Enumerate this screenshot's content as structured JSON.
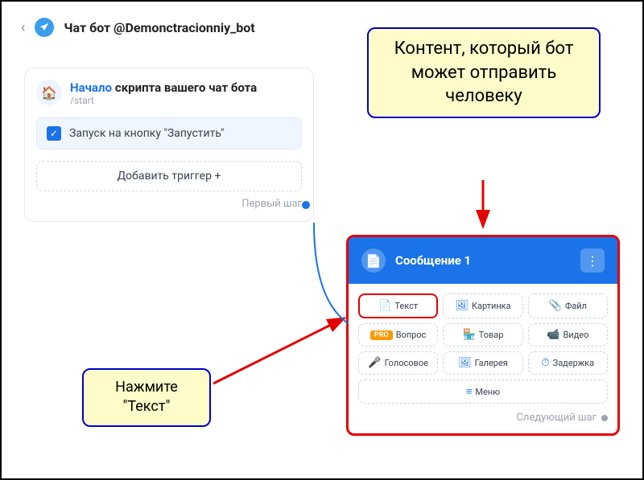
{
  "header": {
    "title": "Чат бот @Demonctracionniy_bot"
  },
  "start_card": {
    "title": "Начало",
    "subtitle_suffix": "скрипта вашего чат бота",
    "command": "/start",
    "trigger_text": "Запуск на кнопку \"Запустить\"",
    "add_trigger": "Добавить триггер",
    "first_step": "Первый шаг"
  },
  "message_card": {
    "title": "Сообщение 1",
    "buttons": [
      {
        "label": "Текст",
        "icon": "📄",
        "highlighted": true
      },
      {
        "label": "Картинка",
        "icon": "🖼"
      },
      {
        "label": "Файл",
        "icon": "📎"
      },
      {
        "label": "Вопрос",
        "icon": "",
        "pro": true
      },
      {
        "label": "Товар",
        "icon": "🏪"
      },
      {
        "label": "Видео",
        "icon": "📹"
      },
      {
        "label": "Голосовое",
        "icon": "🎤"
      },
      {
        "label": "Галерея",
        "icon": "🖼"
      },
      {
        "label": "Задержка",
        "icon": "⏱"
      },
      {
        "label": "Меню",
        "icon": "≡",
        "full": true
      }
    ],
    "next_step": "Следующий шаг",
    "pro_label": "PRO"
  },
  "callouts": {
    "top": "Контент, который бот может отправить человеку",
    "bottom": "Нажмите \"Текст\""
  }
}
